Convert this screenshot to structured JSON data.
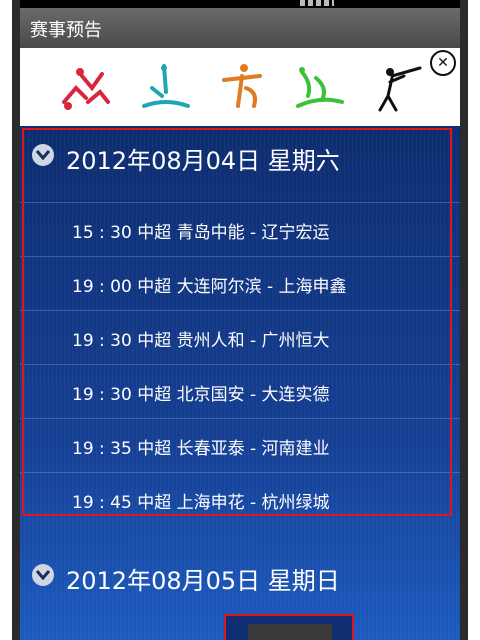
{
  "header": {
    "title": "赛事预告"
  },
  "banner": {
    "icons": [
      "gymnastics-pictogram",
      "diving-pictogram",
      "taekwondo-pictogram",
      "swimming-pictogram",
      "shooting-pictogram"
    ],
    "colors": [
      "#d7263d",
      "#1fa6b6",
      "#e07b1f",
      "#3cc13b",
      "#111111"
    ]
  },
  "days": [
    {
      "date_label": "2012年08月04日 星期六",
      "matches": [
        "15 : 30 中超 青岛中能 - 辽宁宏运",
        "19 : 00 中超 大连阿尔滨 - 上海申鑫",
        "19 : 30 中超 贵州人和 - 广州恒大",
        "19 : 30 中超 北京国安 - 大连实德",
        "19 : 35 中超 长春亚泰 - 河南建业",
        "19 : 45 中超 上海申花 - 杭州绿城"
      ]
    },
    {
      "date_label": "2012年08月05日 星期日",
      "matches": []
    }
  ],
  "theme": {
    "list_bg": "#163f93",
    "highlight": "#e0141e",
    "titlebar": "#5a5a5a"
  }
}
